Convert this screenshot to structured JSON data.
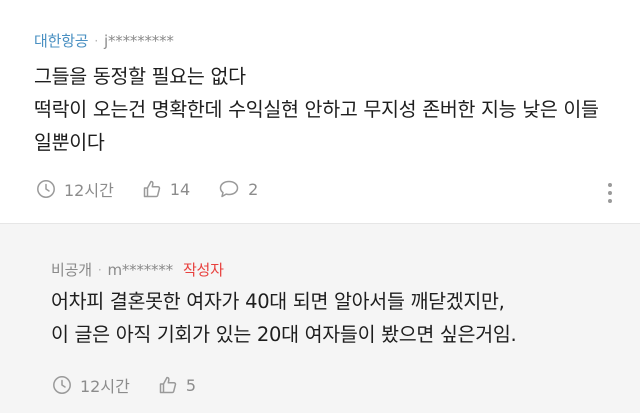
{
  "comments": [
    {
      "author": "대한항공",
      "separator": "·",
      "masked_id": "j*********",
      "badge": "",
      "text": "그들을 동정할 필요는 없다\n떡락이 오는건 명확한데 수익실현 안하고 무지성 존버한 지능 낮은 이들일뿐이다",
      "time": "12시간",
      "likes": "14",
      "replies": "2"
    },
    {
      "author": "비공개",
      "separator": "·",
      "masked_id": "m*******",
      "badge": "작성자",
      "text": "어차피 결혼못한 여자가 40대 되면 알아서들 깨닫겠지만,\n이 글은 아직 기회가 있는 20대 여자들이 봤으면 싶은거임.",
      "time": "12시간",
      "likes": "5",
      "replies": ""
    }
  ],
  "icons": {
    "clock": "clock-icon",
    "like": "thumbs-up-icon",
    "reply": "speech-bubble-icon",
    "more": "more-vertical-icon"
  },
  "colors": {
    "author_link": "#4a90c2",
    "writer_badge": "#e8413e",
    "reply_background": "#f5f5f5",
    "meta_gray": "#8c8c8c"
  }
}
